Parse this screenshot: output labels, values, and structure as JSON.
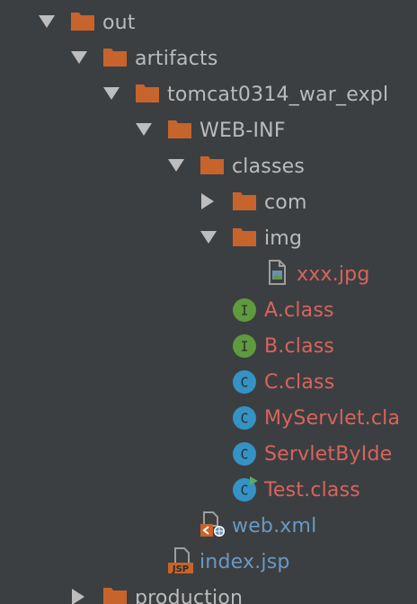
{
  "colors": {
    "background": "#3c3f41",
    "text_default": "#bbbbbb",
    "text_modified": "#d8635d",
    "text_xml": "#6899c5",
    "folder": "#c7642b",
    "interface_icon": "#5f9a3f",
    "class_icon": "#3592c4"
  },
  "tree": {
    "items": [
      {
        "label": "out",
        "kind": "folder",
        "state": "expanded"
      },
      {
        "label": "artifacts",
        "kind": "folder",
        "state": "expanded"
      },
      {
        "label": "tomcat0314_war_expl",
        "kind": "folder",
        "state": "expanded"
      },
      {
        "label": "WEB-INF",
        "kind": "folder",
        "state": "expanded"
      },
      {
        "label": "classes",
        "kind": "folder",
        "state": "expanded"
      },
      {
        "label": "com",
        "kind": "folder",
        "state": "collapsed"
      },
      {
        "label": "img",
        "kind": "folder",
        "state": "expanded"
      },
      {
        "label": "xxx.jpg",
        "kind": "image-file",
        "icon": "image-file-icon"
      },
      {
        "label": "A.class",
        "kind": "interface",
        "icon": "interface-icon",
        "icon_letter": "I"
      },
      {
        "label": "B.class",
        "kind": "interface",
        "icon": "interface-icon",
        "icon_letter": "I"
      },
      {
        "label": "C.class",
        "kind": "class",
        "icon": "class-icon",
        "icon_letter": "C"
      },
      {
        "label": "MyServlet.cla",
        "kind": "class",
        "icon": "class-icon",
        "icon_letter": "C"
      },
      {
        "label": "ServletByIde",
        "kind": "class",
        "icon": "class-icon",
        "icon_letter": "C"
      },
      {
        "label": "Test.class",
        "kind": "runnable-class",
        "icon": "runnable-class-icon",
        "icon_letter": "C"
      },
      {
        "label": "web.xml",
        "kind": "xml-file",
        "icon": "xml-file-icon"
      },
      {
        "label": "index.jsp",
        "kind": "jsp-file",
        "icon": "jsp-file-icon",
        "icon_text": "JSP"
      },
      {
        "label": "production",
        "kind": "folder",
        "state": "collapsed"
      }
    ]
  }
}
